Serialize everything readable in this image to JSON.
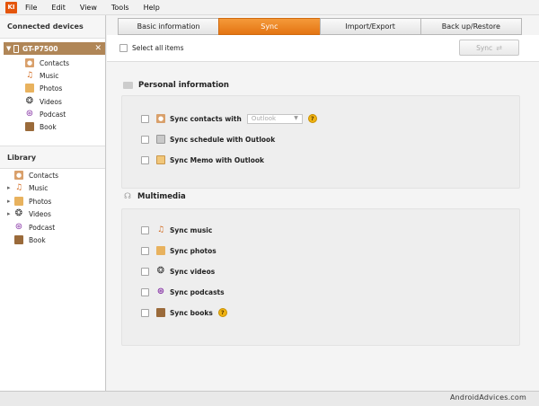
{
  "menu": {
    "logo": "KI",
    "items": [
      "File",
      "Edit",
      "View",
      "Tools",
      "Help"
    ]
  },
  "sidebar": {
    "connected_title": "Connected devices",
    "device_name": "GT-P7500",
    "device_items": [
      "Contacts",
      "Music",
      "Photos",
      "Videos",
      "Podcast",
      "Book"
    ],
    "library_title": "Library",
    "library_items": [
      "Contacts",
      "Music",
      "Photos",
      "Videos",
      "Podcast",
      "Book"
    ]
  },
  "tabs": [
    "Basic information",
    "Sync",
    "Import/Export",
    "Back up/Restore"
  ],
  "active_tab": "Sync",
  "toolbar": {
    "select_all": "Select all items",
    "sync_button": "Sync"
  },
  "personal": {
    "title": "Personal information",
    "sync_contacts": "Sync contacts with",
    "contacts_target": "Outlook",
    "sync_schedule": "Sync schedule with Outlook",
    "sync_memo": "Sync Memo with Outlook"
  },
  "multimedia": {
    "title": "Multimedia",
    "sync_music": "Sync music",
    "sync_photos": "Sync photos",
    "sync_videos": "Sync videos",
    "sync_podcasts": "Sync podcasts",
    "sync_books": "Sync books"
  },
  "help_glyph": "?",
  "watermark": "AndroidAdvices.com",
  "colors": {
    "accent": "#e37412",
    "device_highlight": "#b08657"
  }
}
